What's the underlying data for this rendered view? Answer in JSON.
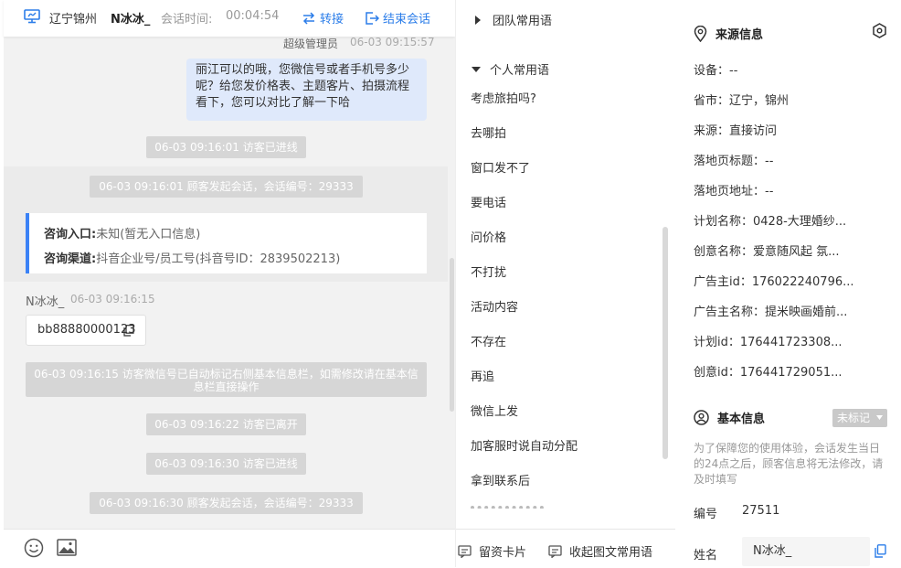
{
  "header": {
    "location": "辽宁锦州",
    "nickname": "N冰冰_",
    "session_time_label": "会话时间:",
    "session_time": "00:04:54",
    "transfer_label": "转接",
    "end_label": "结束会话"
  },
  "messages": {
    "admin_sender": "超级管理员",
    "admin_time": "06-03 09:15:57",
    "admin_text": "丽江可以的哦，您微信号或者手机号多少呢？给您发价格表、主题客片、拍摄流程看下，您可以对比了解一下哈",
    "sys1": "06-03 09:16:01 访客已进线",
    "sys2": "06-03 09:16:01 顾客发起会话，会话编号：29333",
    "consult_entry_label": "咨询入口:",
    "consult_entry_value": "未知(暂无入口信息)",
    "consult_channel_label": "咨询渠道:",
    "consult_channel_value": "抖音企业号/员工号(抖音号ID：2839502213)",
    "visitor_sender": "N冰冰_",
    "visitor_time": "06-03 09:16:15",
    "visitor_text": "bb88880000123",
    "sys3": "06-03 09:16:15 访客微信号已自动标记右侧基本信息栏，如需修改请在基本信息栏直接操作",
    "sys4": "06-03 09:16:22 访客已离开",
    "sys5": "06-03 09:16:30 访客已进线",
    "sys6": "06-03 09:16:30 顾客发起会话，会话编号：29333"
  },
  "phrases": {
    "team_label": "团队常用语",
    "personal_label": "个人常用语",
    "items": [
      "考虑旅拍吗?",
      "去哪拍",
      "窗口发不了",
      "要电话",
      "问价格",
      "不打扰",
      "活动内容",
      "不存在",
      "再追",
      "微信上发",
      "加客服时说自动分配",
      "拿到联系后"
    ],
    "leave_card_label": "留资卡片",
    "collapse_label": "收起图文常用语"
  },
  "source_info": {
    "title": "来源信息",
    "rows": [
      "设备：--",
      "省市：辽宁，锦州",
      "来源：直接访问",
      "落地页标题：--",
      "落地页地址：--",
      "计划名称：0428-大理婚纱...",
      "创意名称：爱意随风起 氛...",
      "广告主id：176022240796...",
      "广告主名称：提米映画婚前...",
      "计划id：176441723308...",
      "创意id：176441729051..."
    ]
  },
  "basic_info": {
    "title": "基本信息",
    "tag_label": "未标记",
    "notice": "为了保障您的使用体验，会话发生当日的24点之后，顾客信息将无法修改，请及时填写",
    "id_label": "编号",
    "id_value": "27511",
    "name_label": "姓名",
    "name_value": "N冰冰_"
  }
}
